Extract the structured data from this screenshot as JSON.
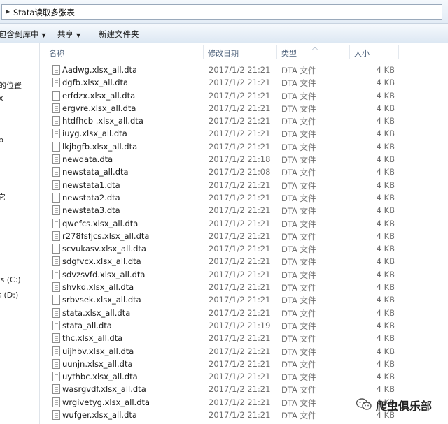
{
  "address": {
    "path": "Stata读取多张表"
  },
  "toolbar": {
    "include_library": "包含到库中",
    "share": "共享",
    "new_folder": "新建文件夹"
  },
  "nav": {
    "items": [
      "的位置",
      "x",
      "p",
      "它",
      "vs (C:)",
      "盘 (D:)"
    ]
  },
  "columns": {
    "name": "名称",
    "date": "修改日期",
    "type": "类型",
    "size": "大小"
  },
  "files": [
    {
      "name": "Aadwg.xlsx_all.dta",
      "date": "2017/1/2 21:21",
      "type": "DTA 文件",
      "size": "4 KB"
    },
    {
      "name": "dgfb.xlsx_all.dta",
      "date": "2017/1/2 21:21",
      "type": "DTA 文件",
      "size": "4 KB"
    },
    {
      "name": "erfdzx.xlsx_all.dta",
      "date": "2017/1/2 21:21",
      "type": "DTA 文件",
      "size": "4 KB"
    },
    {
      "name": "ergvre.xlsx_all.dta",
      "date": "2017/1/2 21:21",
      "type": "DTA 文件",
      "size": "4 KB"
    },
    {
      "name": "htdfhcb .xlsx_all.dta",
      "date": "2017/1/2 21:21",
      "type": "DTA 文件",
      "size": "4 KB"
    },
    {
      "name": "iuyg.xlsx_all.dta",
      "date": "2017/1/2 21:21",
      "type": "DTA 文件",
      "size": "4 KB"
    },
    {
      "name": "lkjbgfb.xlsx_all.dta",
      "date": "2017/1/2 21:21",
      "type": "DTA 文件",
      "size": "4 KB"
    },
    {
      "name": "newdata.dta",
      "date": "2017/1/2 21:18",
      "type": "DTA 文件",
      "size": "4 KB"
    },
    {
      "name": "newstata_all.dta",
      "date": "2017/1/2 21:08",
      "type": "DTA 文件",
      "size": "4 KB"
    },
    {
      "name": "newstata1.dta",
      "date": "2017/1/2 21:21",
      "type": "DTA 文件",
      "size": "4 KB"
    },
    {
      "name": "newstata2.dta",
      "date": "2017/1/2 21:21",
      "type": "DTA 文件",
      "size": "4 KB"
    },
    {
      "name": "newstata3.dta",
      "date": "2017/1/2 21:21",
      "type": "DTA 文件",
      "size": "4 KB"
    },
    {
      "name": "qwefcs.xlsx_all.dta",
      "date": "2017/1/2 21:21",
      "type": "DTA 文件",
      "size": "4 KB"
    },
    {
      "name": "r278fsfjcs.xlsx_all.dta",
      "date": "2017/1/2 21:21",
      "type": "DTA 文件",
      "size": "4 KB"
    },
    {
      "name": "scvukasv.xlsx_all.dta",
      "date": "2017/1/2 21:21",
      "type": "DTA 文件",
      "size": "4 KB"
    },
    {
      "name": "sdgfvcx.xlsx_all.dta",
      "date": "2017/1/2 21:21",
      "type": "DTA 文件",
      "size": "4 KB"
    },
    {
      "name": "sdvzsvfd.xlsx_all.dta",
      "date": "2017/1/2 21:21",
      "type": "DTA 文件",
      "size": "4 KB"
    },
    {
      "name": "shvkd.xlsx_all.dta",
      "date": "2017/1/2 21:21",
      "type": "DTA 文件",
      "size": "4 KB"
    },
    {
      "name": "srbvsek.xlsx_all.dta",
      "date": "2017/1/2 21:21",
      "type": "DTA 文件",
      "size": "4 KB"
    },
    {
      "name": "stata.xlsx_all.dta",
      "date": "2017/1/2 21:21",
      "type": "DTA 文件",
      "size": "4 KB"
    },
    {
      "name": "stata_all.dta",
      "date": "2017/1/2 21:19",
      "type": "DTA 文件",
      "size": "4 KB"
    },
    {
      "name": "thc.xlsx_all.dta",
      "date": "2017/1/2 21:21",
      "type": "DTA 文件",
      "size": "4 KB"
    },
    {
      "name": "uijhbv.xlsx_all.dta",
      "date": "2017/1/2 21:21",
      "type": "DTA 文件",
      "size": "4 KB"
    },
    {
      "name": "uunjn.xlsx_all.dta",
      "date": "2017/1/2 21:21",
      "type": "DTA 文件",
      "size": "4 KB"
    },
    {
      "name": "uythbc.xlsx_all.dta",
      "date": "2017/1/2 21:21",
      "type": "DTA 文件",
      "size": "4 KB"
    },
    {
      "name": "wasrgvdf.xlsx_all.dta",
      "date": "2017/1/2 21:21",
      "type": "DTA 文件",
      "size": "4 KB"
    },
    {
      "name": "wrgivetyg.xlsx_all.dta",
      "date": "2017/1/2 21:21",
      "type": "DTA 文件",
      "size": "4 KB"
    },
    {
      "name": "wufger.xlsx_all.dta",
      "date": "2017/1/2 21:21",
      "type": "DTA 文件",
      "size": "4 KB"
    }
  ],
  "watermark": {
    "text": "爬虫俱乐部",
    "icon": "wechat-icon"
  }
}
